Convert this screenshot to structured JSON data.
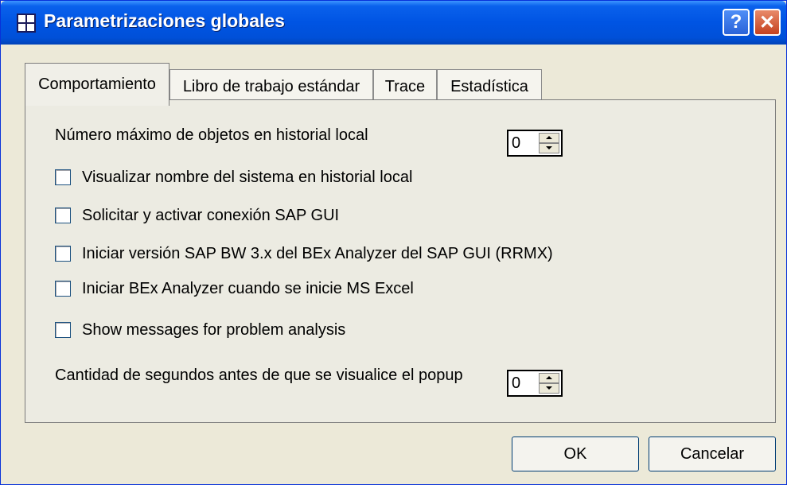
{
  "window": {
    "title": "Parametrizaciones globales",
    "help_label": "?",
    "close_label": "✕",
    "icon": "table-grid-icon"
  },
  "tabs": [
    {
      "label": "Comportamiento",
      "active": true
    },
    {
      "label": "Libro de trabajo estándar",
      "active": false
    },
    {
      "label": "Trace",
      "active": false
    },
    {
      "label": "Estadística",
      "active": false
    }
  ],
  "panel": {
    "max_objects_label": "Número máximo de objetos en historial local",
    "max_objects_value": "0",
    "checkboxes": [
      {
        "label": "Visualizar nombre del sistema en historial local",
        "checked": false
      },
      {
        "label": "Solicitar y activar conexión SAP GUI",
        "checked": false
      },
      {
        "label": "Iniciar versión SAP BW 3.x del BEx Analyzer del SAP GUI (RRMX)",
        "checked": false
      },
      {
        "label": "Iniciar BEx Analyzer cuando se inicie MS Excel",
        "checked": false
      },
      {
        "label": "Show messages for problem analysis",
        "checked": false
      }
    ],
    "popup_seconds_label": "Cantidad de segundos antes de que se visualice el popup",
    "popup_seconds_value": "0"
  },
  "buttons": {
    "ok": "OK",
    "cancel": "Cancelar"
  },
  "colors": {
    "titlebar": "#0054e3",
    "window_bg": "#ece9d8",
    "close_button": "#c5411f"
  }
}
